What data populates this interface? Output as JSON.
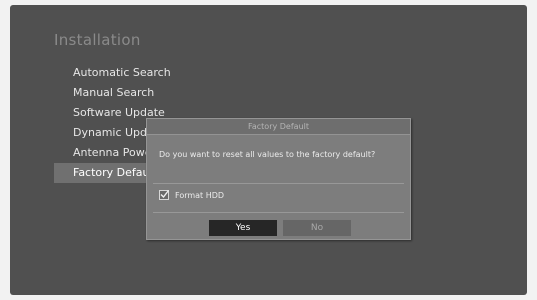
{
  "screen": {
    "title": "Installation",
    "menu": [
      {
        "label": "Automatic Search",
        "selected": false
      },
      {
        "label": "Manual Search",
        "selected": false
      },
      {
        "label": "Software Update",
        "selected": false
      },
      {
        "label": "Dynamic Update",
        "selected": false
      },
      {
        "label": "Antenna Power",
        "selected": false
      },
      {
        "label": "Factory Default",
        "selected": true
      }
    ]
  },
  "dialog": {
    "title": "Factory Default",
    "message": "Do you want to reset all values to the factory default?",
    "checkbox": {
      "label": "Format HDD",
      "checked": true
    },
    "yes_label": "Yes",
    "no_label": "No"
  },
  "colors": {
    "screen_bg": "#505050",
    "selected_bg": "#707070",
    "dialog_bg": "#7d7d7d",
    "focused_button": "#262626"
  },
  "icons": {
    "checkbox_mark": "checkmark-icon"
  }
}
